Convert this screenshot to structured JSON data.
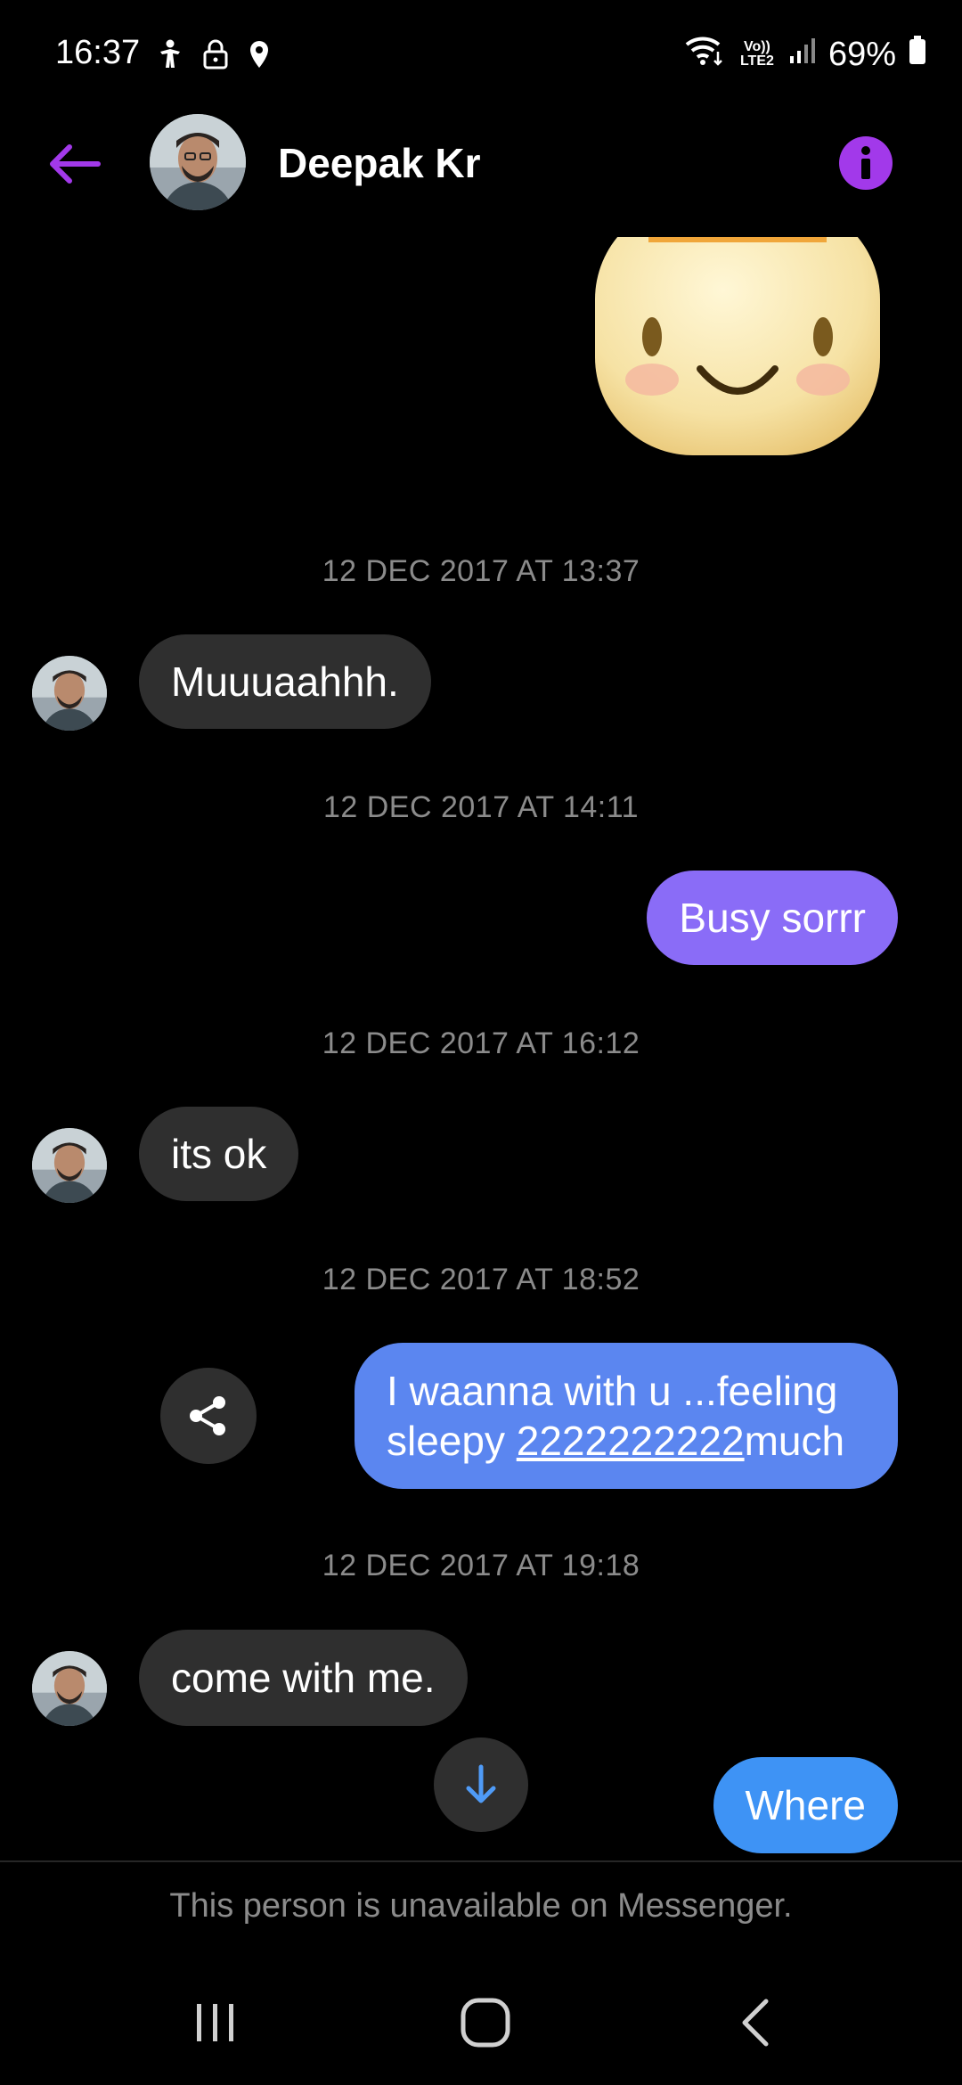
{
  "status_bar": {
    "time": "16:37",
    "network": "Vo)) LTE2",
    "battery": "69%",
    "icons_left": [
      "accessibility-icon",
      "lock-icon",
      "location-icon"
    ],
    "icons_right": [
      "wifi-icon",
      "volte-icon",
      "signal-icon",
      "battery-icon"
    ]
  },
  "header": {
    "contact_name": "Deepak Kr",
    "back_icon": "back-arrow-icon",
    "info_icon": "info-icon",
    "accent_color": "#a239ea"
  },
  "messages": [
    {
      "type": "sticker",
      "direction": "outgoing",
      "name": "smiling-face-sticker"
    },
    {
      "type": "timestamp",
      "text": "12 DEC 2017 AT 13:37"
    },
    {
      "type": "text",
      "direction": "incoming",
      "text": "Muuuaahhh."
    },
    {
      "type": "timestamp",
      "text": "12 DEC 2017 AT 14:11"
    },
    {
      "type": "text",
      "direction": "outgoing",
      "text": "Busy sorrr"
    },
    {
      "type": "timestamp",
      "text": "12 DEC 2017 AT 16:12"
    },
    {
      "type": "text",
      "direction": "incoming",
      "text": "its ok"
    },
    {
      "type": "timestamp",
      "text": "12 DEC 2017 AT 18:52"
    },
    {
      "type": "text",
      "direction": "outgoing",
      "line1": "I waanna with u ...feeling",
      "line2_prefix": "sleepy ",
      "line2_link": "2222222222",
      "line2_suffix": "much"
    },
    {
      "type": "timestamp",
      "text": "12 DEC 2017 AT 19:18"
    },
    {
      "type": "text",
      "direction": "incoming",
      "text": "come with me."
    },
    {
      "type": "text",
      "direction": "outgoing",
      "text": "Where"
    }
  ],
  "bubble_colors": {
    "incoming": "#2f2f2f",
    "outgoing_purple": "#8a6cf7",
    "outgoing_blue": "#5b86f0",
    "outgoing_light_blue": "#3e93f5"
  },
  "controls": {
    "share_icon": "share-icon",
    "scroll_down_icon": "arrow-down-icon"
  },
  "footer": {
    "notice": "This person is unavailable on Messenger."
  },
  "nav_bar": [
    "recents-icon",
    "home-icon",
    "back-icon"
  ]
}
